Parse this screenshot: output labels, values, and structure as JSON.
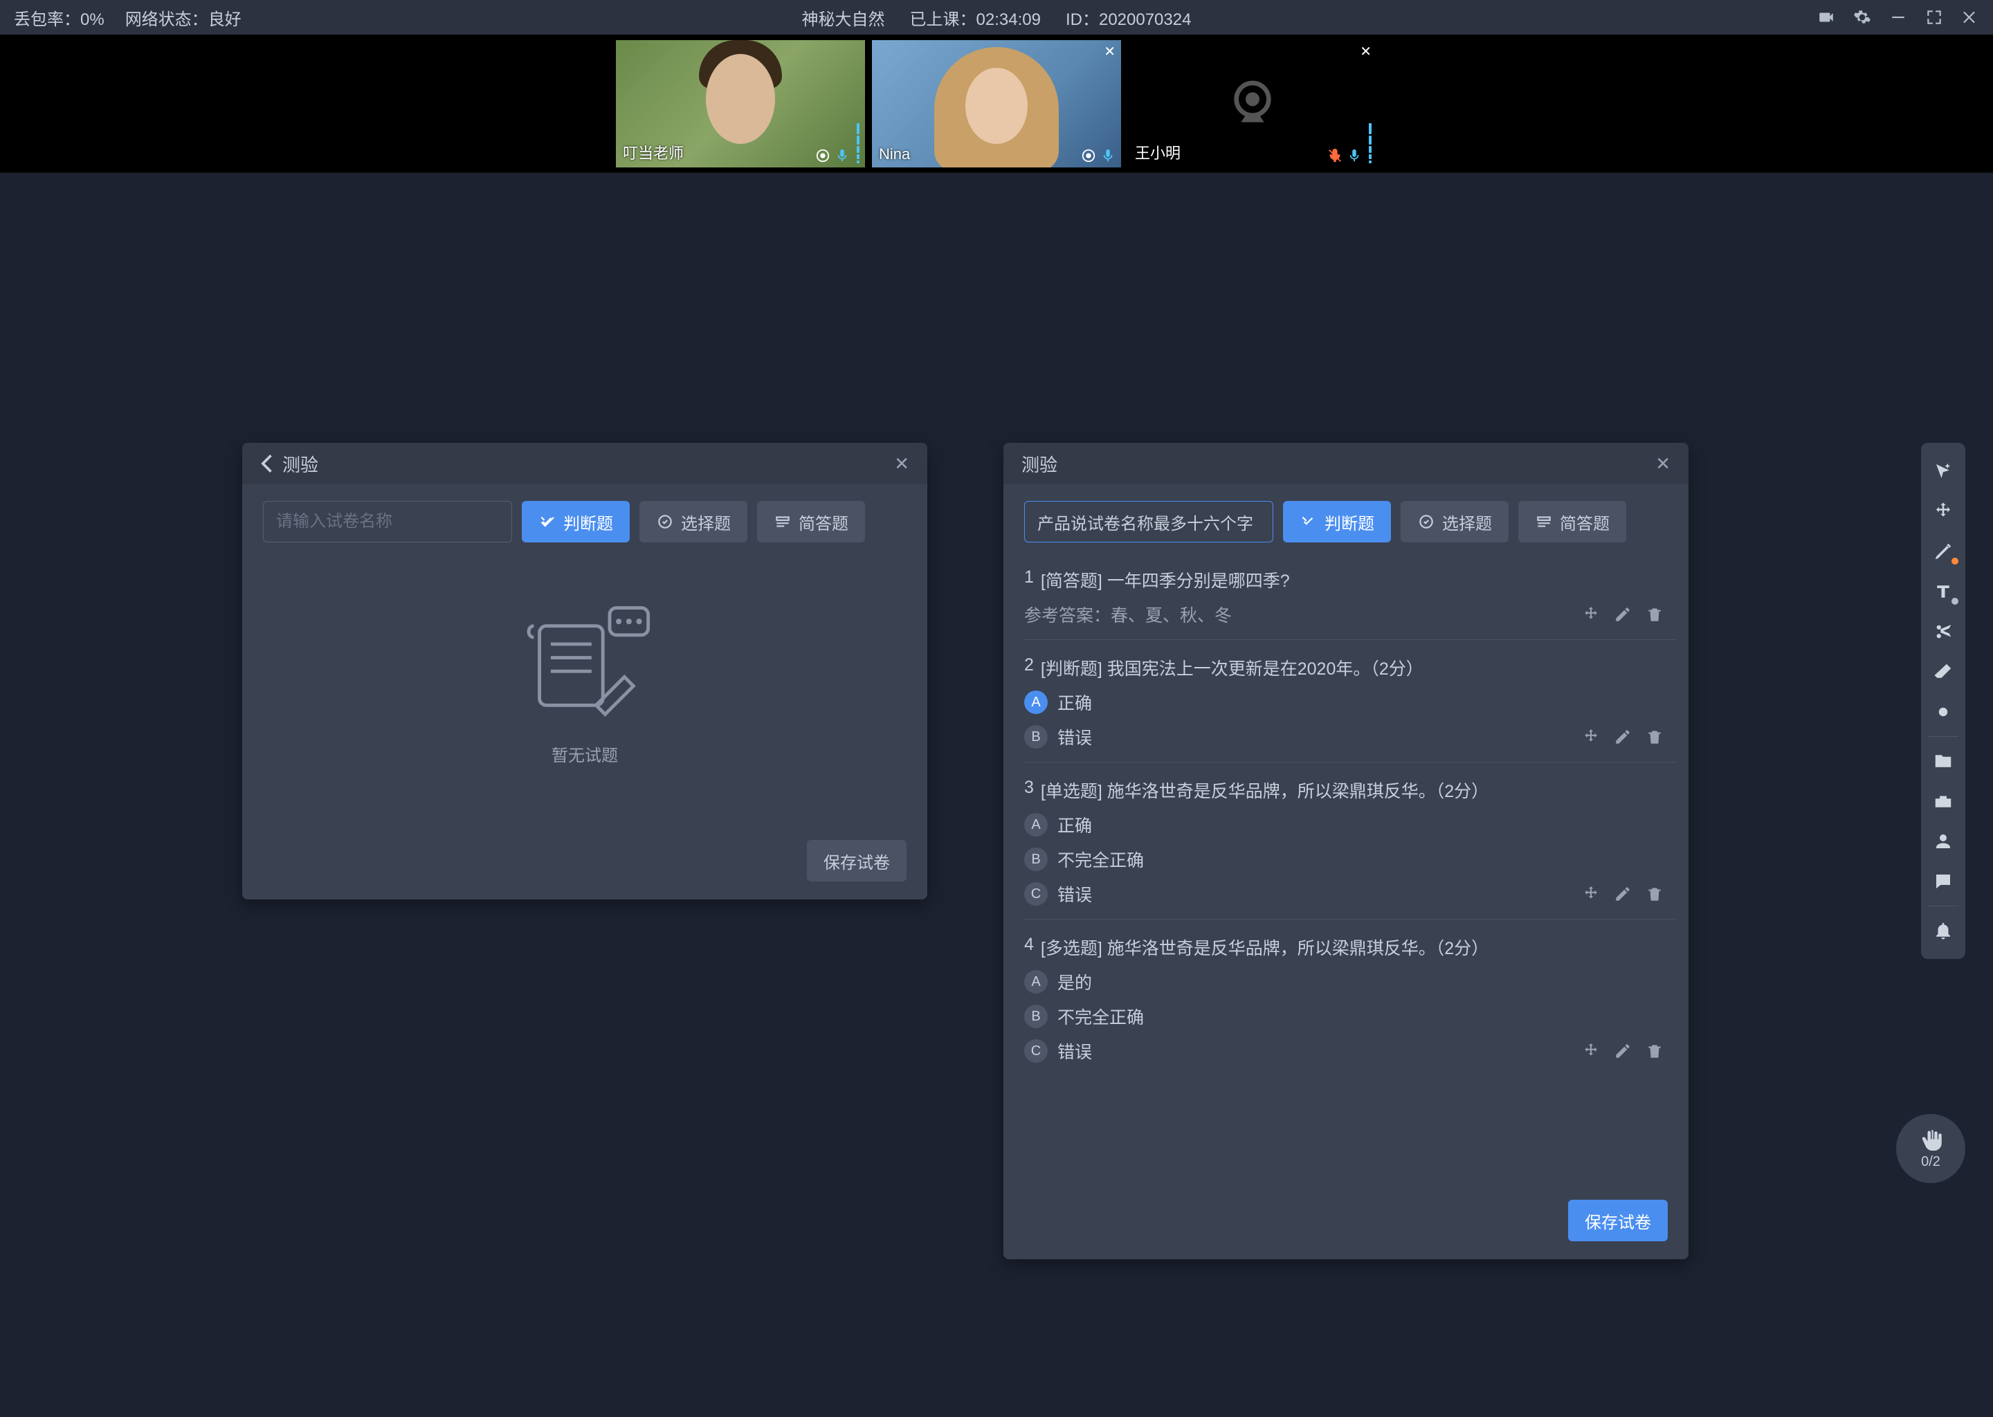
{
  "header": {
    "packet_loss_label": "丢包率：",
    "packet_loss_value": "0%",
    "network_label": "网络状态：",
    "network_value": "良好",
    "course_title": "神秘大自然",
    "elapsed_label": "已上课：",
    "elapsed_value": "02:34:09",
    "id_label": "ID：",
    "id_value": "2020070324"
  },
  "videos": [
    {
      "name": "叮当老师",
      "role": "teacher",
      "camera_on": true,
      "mic_on": true,
      "closable": false
    },
    {
      "name": "Nina",
      "role": "student",
      "camera_on": true,
      "mic_on": true,
      "closable": true
    },
    {
      "name": "王小明",
      "role": "student",
      "camera_on": false,
      "mic_on": true,
      "mic_muted_icon": true,
      "closable": true
    }
  ],
  "panel_left": {
    "title": "测验",
    "back": true,
    "name_placeholder": "请输入试卷名称",
    "buttons": {
      "judge": "判断题",
      "select": "选择题",
      "short": "简答题"
    },
    "empty_text": "暂无试题",
    "save_label": "保存试卷"
  },
  "panel_right": {
    "title": "测验",
    "name_value": "产品说试卷名称最多十六个字",
    "buttons": {
      "judge": "判断题",
      "select": "选择题",
      "short": "简答题"
    },
    "save_label": "保存试卷",
    "answer_prefix": "参考答案：",
    "questions": [
      {
        "index": "1",
        "type_label": "[简答题]",
        "text": "一年四季分别是哪四季?",
        "answer": "春、夏、秋、冬",
        "kind": "short"
      },
      {
        "index": "2",
        "type_label": "[判断题]",
        "text": "我国宪法上一次更新是在2020年。（2分）",
        "kind": "choice",
        "options": [
          {
            "letter": "A",
            "text": "正确",
            "correct": true
          },
          {
            "letter": "B",
            "text": "错误",
            "correct": false
          }
        ]
      },
      {
        "index": "3",
        "type_label": "[单选题]",
        "text": "施华洛世奇是反华品牌，所以梁鼎琪反华。（2分）",
        "kind": "choice",
        "options": [
          {
            "letter": "A",
            "text": "正确",
            "correct": false
          },
          {
            "letter": "B",
            "text": "不完全正确",
            "correct": false
          },
          {
            "letter": "C",
            "text": "错误",
            "correct": false
          }
        ]
      },
      {
        "index": "4",
        "type_label": "[多选题]",
        "text": "施华洛世奇是反华品牌，所以梁鼎琪反华。（2分）",
        "kind": "choice",
        "options": [
          {
            "letter": "A",
            "text": "是的",
            "correct": false
          },
          {
            "letter": "B",
            "text": "不完全正确",
            "correct": false
          },
          {
            "letter": "C",
            "text": "错误",
            "correct": false
          }
        ]
      }
    ]
  },
  "toolbar_icons": [
    "cursor-sparkle-icon",
    "move-icon",
    "pen-icon",
    "text-icon",
    "scissors-icon",
    "eraser-icon",
    "color-dot-icon",
    "folder-icon",
    "toolbox-icon",
    "person-icon",
    "chat-icon",
    "bell-icon"
  ],
  "hand_raise": {
    "count": "0/2"
  }
}
